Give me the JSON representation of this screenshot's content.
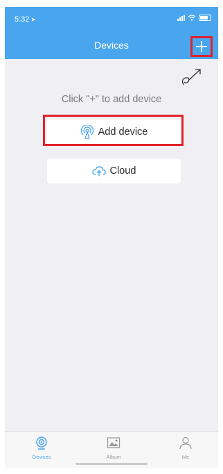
{
  "status_bar": {
    "time": "5:32"
  },
  "header": {
    "title": "Devices"
  },
  "main": {
    "hint": "Click \"+\" to add device",
    "add_device_label": "Add device",
    "cloud_label": "Cloud"
  },
  "tabs": [
    {
      "label": "Devices",
      "icon": "camera-icon",
      "active": true
    },
    {
      "label": "Album",
      "icon": "image-icon",
      "active": false
    },
    {
      "label": "Me",
      "icon": "person-icon",
      "active": false
    }
  ],
  "colors": {
    "accent": "#49a6ee",
    "highlight": "#e3202b",
    "background": "#efeff4"
  }
}
